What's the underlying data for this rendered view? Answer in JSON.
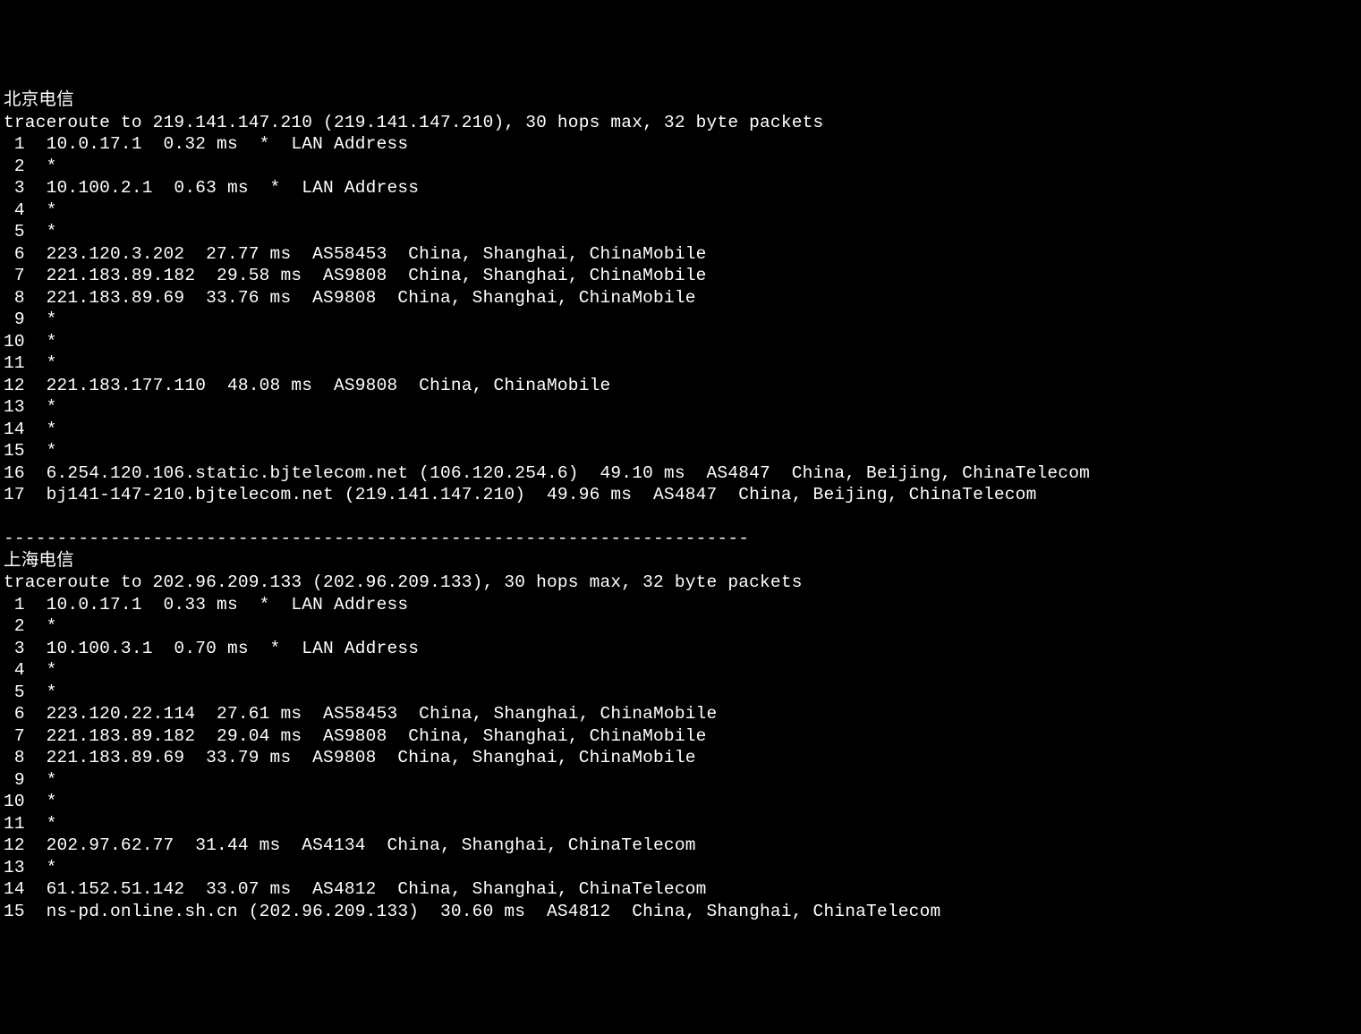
{
  "sections": [
    {
      "title": "北京电信",
      "target_ip": "219.141.147.210",
      "target_display": "219.141.147.210",
      "header": "traceroute to 219.141.147.210 (219.141.147.210), 30 hops max, 32 byte packets",
      "hops": [
        {
          "n": 1,
          "host": "10.0.17.1",
          "rtt": "0.32 ms",
          "marker": "*",
          "asn": "",
          "loc": "LAN Address"
        },
        {
          "n": 2,
          "host": "*",
          "rtt": "",
          "marker": "",
          "asn": "",
          "loc": ""
        },
        {
          "n": 3,
          "host": "10.100.2.1",
          "rtt": "0.63 ms",
          "marker": "*",
          "asn": "",
          "loc": "LAN Address"
        },
        {
          "n": 4,
          "host": "*",
          "rtt": "",
          "marker": "",
          "asn": "",
          "loc": ""
        },
        {
          "n": 5,
          "host": "*",
          "rtt": "",
          "marker": "",
          "asn": "",
          "loc": ""
        },
        {
          "n": 6,
          "host": "223.120.3.202",
          "rtt": "27.77 ms",
          "marker": "",
          "asn": "AS58453",
          "loc": "China, Shanghai, ChinaMobile"
        },
        {
          "n": 7,
          "host": "221.183.89.182",
          "rtt": "29.58 ms",
          "marker": "",
          "asn": "AS9808",
          "loc": "China, Shanghai, ChinaMobile"
        },
        {
          "n": 8,
          "host": "221.183.89.69",
          "rtt": "33.76 ms",
          "marker": "",
          "asn": "AS9808",
          "loc": "China, Shanghai, ChinaMobile"
        },
        {
          "n": 9,
          "host": "*",
          "rtt": "",
          "marker": "",
          "asn": "",
          "loc": ""
        },
        {
          "n": 10,
          "host": "*",
          "rtt": "",
          "marker": "",
          "asn": "",
          "loc": ""
        },
        {
          "n": 11,
          "host": "*",
          "rtt": "",
          "marker": "",
          "asn": "",
          "loc": ""
        },
        {
          "n": 12,
          "host": "221.183.177.110",
          "rtt": "48.08 ms",
          "marker": "",
          "asn": "AS9808",
          "loc": "China, ChinaMobile"
        },
        {
          "n": 13,
          "host": "*",
          "rtt": "",
          "marker": "",
          "asn": "",
          "loc": ""
        },
        {
          "n": 14,
          "host": "*",
          "rtt": "",
          "marker": "",
          "asn": "",
          "loc": ""
        },
        {
          "n": 15,
          "host": "*",
          "rtt": "",
          "marker": "",
          "asn": "",
          "loc": ""
        },
        {
          "n": 16,
          "host": "6.254.120.106.static.bjtelecom.net (106.120.254.6)",
          "rtt": "49.10 ms",
          "marker": "",
          "asn": "AS4847",
          "loc": "China, Beijing, ChinaTelecom"
        },
        {
          "n": 17,
          "host": "bj141-147-210.bjtelecom.net (219.141.147.210)",
          "rtt": "49.96 ms",
          "marker": "",
          "asn": "AS4847",
          "loc": "China, Beijing, ChinaTelecom"
        }
      ]
    },
    {
      "title": "上海电信",
      "target_ip": "202.96.209.133",
      "target_display": "202.96.209.133",
      "header": "traceroute to 202.96.209.133 (202.96.209.133), 30 hops max, 32 byte packets",
      "hops": [
        {
          "n": 1,
          "host": "10.0.17.1",
          "rtt": "0.33 ms",
          "marker": "*",
          "asn": "",
          "loc": "LAN Address"
        },
        {
          "n": 2,
          "host": "*",
          "rtt": "",
          "marker": "",
          "asn": "",
          "loc": ""
        },
        {
          "n": 3,
          "host": "10.100.3.1",
          "rtt": "0.70 ms",
          "marker": "*",
          "asn": "",
          "loc": "LAN Address"
        },
        {
          "n": 4,
          "host": "*",
          "rtt": "",
          "marker": "",
          "asn": "",
          "loc": ""
        },
        {
          "n": 5,
          "host": "*",
          "rtt": "",
          "marker": "",
          "asn": "",
          "loc": ""
        },
        {
          "n": 6,
          "host": "223.120.22.114",
          "rtt": "27.61 ms",
          "marker": "",
          "asn": "AS58453",
          "loc": "China, Shanghai, ChinaMobile"
        },
        {
          "n": 7,
          "host": "221.183.89.182",
          "rtt": "29.04 ms",
          "marker": "",
          "asn": "AS9808",
          "loc": "China, Shanghai, ChinaMobile"
        },
        {
          "n": 8,
          "host": "221.183.89.69",
          "rtt": "33.79 ms",
          "marker": "",
          "asn": "AS9808",
          "loc": "China, Shanghai, ChinaMobile"
        },
        {
          "n": 9,
          "host": "*",
          "rtt": "",
          "marker": "",
          "asn": "",
          "loc": ""
        },
        {
          "n": 10,
          "host": "*",
          "rtt": "",
          "marker": "",
          "asn": "",
          "loc": ""
        },
        {
          "n": 11,
          "host": "*",
          "rtt": "",
          "marker": "",
          "asn": "",
          "loc": ""
        },
        {
          "n": 12,
          "host": "202.97.62.77",
          "rtt": "31.44 ms",
          "marker": "",
          "asn": "AS4134",
          "loc": "China, Shanghai, ChinaTelecom"
        },
        {
          "n": 13,
          "host": "*",
          "rtt": "",
          "marker": "",
          "asn": "",
          "loc": ""
        },
        {
          "n": 14,
          "host": "61.152.51.142",
          "rtt": "33.07 ms",
          "marker": "",
          "asn": "AS4812",
          "loc": "China, Shanghai, ChinaTelecom"
        },
        {
          "n": 15,
          "host": "ns-pd.online.sh.cn (202.96.209.133)",
          "rtt": "30.60 ms",
          "marker": "",
          "asn": "AS4812",
          "loc": "China, Shanghai, ChinaTelecom"
        }
      ]
    }
  ],
  "separator": "----------------------------------------------------------------------"
}
